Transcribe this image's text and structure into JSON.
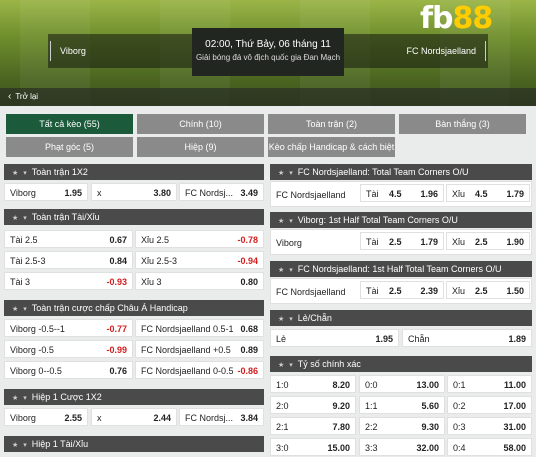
{
  "header": {
    "brand": "fb88",
    "home_team": "Viborg",
    "away_team": "FC Nordsjaelland",
    "datetime": "02:00, Thứ Bảy, 06 tháng 11",
    "league": "Giải bóng đá vô địch quốc gia Đan Mạch",
    "back_label": "Trở lại"
  },
  "filters": [
    {
      "label": "Tất cả kèo (55)",
      "active": true
    },
    {
      "label": "Chính (10)"
    },
    {
      "label": "Toàn trận (2)"
    },
    {
      "label": "Bàn thắng (3)"
    },
    {
      "label": "Phạt góc (5)"
    },
    {
      "label": "Hiệp (9)"
    },
    {
      "label": "Kèo chấp Handicap & cách biệt (1)"
    }
  ],
  "left": {
    "s1": {
      "title": "Toàn trận 1X2",
      "rows": [
        [
          {
            "lbl": "Viborg",
            "odd": "1.95"
          },
          {
            "lbl": "x",
            "odd": "3.80"
          },
          {
            "lbl": "FC Nordsj...",
            "odd": "3.49"
          }
        ]
      ]
    },
    "s2": {
      "title": "Toàn trận Tài/Xỉu",
      "rows": [
        [
          {
            "lbl": "Tài 2.5",
            "odd": "0.67"
          },
          {
            "lbl": "Xỉu 2.5",
            "odd": "-0.78"
          }
        ],
        [
          {
            "lbl": "Tài 2.5-3",
            "odd": "0.84"
          },
          {
            "lbl": "Xỉu 2.5-3",
            "odd": "-0.94"
          }
        ],
        [
          {
            "lbl": "Tài 3",
            "odd": "-0.93"
          },
          {
            "lbl": "Xỉu 3",
            "odd": "0.80"
          }
        ]
      ]
    },
    "s3": {
      "title": "Toàn trận cược chấp Châu Á Handicap",
      "rows": [
        [
          {
            "lbl": "Viborg -0.5--1",
            "odd": "-0.77"
          },
          {
            "lbl": "FC Nordsjaelland 0.5-1",
            "odd": "0.68"
          }
        ],
        [
          {
            "lbl": "Viborg -0.5",
            "odd": "-0.99"
          },
          {
            "lbl": "FC Nordsjaelland +0.5",
            "odd": "0.89"
          }
        ],
        [
          {
            "lbl": "Viborg 0--0.5",
            "odd": "0.76"
          },
          {
            "lbl": "FC Nordsjaelland 0-0.5",
            "odd": "-0.86"
          }
        ]
      ]
    },
    "s4": {
      "title": "Hiệp 1 Cược 1X2",
      "rows": [
        [
          {
            "lbl": "Viborg",
            "odd": "2.55"
          },
          {
            "lbl": "x",
            "odd": "2.44"
          },
          {
            "lbl": "FC Nordsj...",
            "odd": "3.84"
          }
        ]
      ]
    },
    "s5": {
      "title": "Hiệp 1 Tài/Xỉu"
    }
  },
  "right": {
    "r1": {
      "title": "FC Nordsjaelland: Total Team Corners O/U",
      "team": "FC Nordsjaelland",
      "cells": [
        {
          "lbl": "Tài",
          "mid": "4.5",
          "odd": "1.96"
        },
        {
          "lbl": "Xỉu",
          "mid": "4.5",
          "odd": "1.79"
        }
      ]
    },
    "r2": {
      "title": "Viborg: 1st Half Total Team Corners O/U",
      "team": "Viborg",
      "cells": [
        {
          "lbl": "Tài",
          "mid": "2.5",
          "odd": "1.79"
        },
        {
          "lbl": "Xỉu",
          "mid": "2.5",
          "odd": "1.90"
        }
      ]
    },
    "r3": {
      "title": "FC Nordsjaelland: 1st Half Total Team Corners O/U",
      "team": "FC Nordsjaelland",
      "cells": [
        {
          "lbl": "Tài",
          "mid": "2.5",
          "odd": "2.39"
        },
        {
          "lbl": "Xỉu",
          "mid": "2.5",
          "odd": "1.50"
        }
      ]
    },
    "r4": {
      "title": "Lẻ/Chẵn",
      "cells": [
        {
          "lbl": "Lẻ",
          "odd": "1.95"
        },
        {
          "lbl": "Chẵn",
          "odd": "1.89"
        }
      ]
    },
    "r5": {
      "title": "Tỷ số chính xác",
      "rows": [
        [
          {
            "lbl": "1:0",
            "odd": "8.20"
          },
          {
            "lbl": "0:0",
            "odd": "13.00"
          },
          {
            "lbl": "0:1",
            "odd": "11.00"
          }
        ],
        [
          {
            "lbl": "2:0",
            "odd": "9.20"
          },
          {
            "lbl": "1:1",
            "odd": "5.60"
          },
          {
            "lbl": "0:2",
            "odd": "17.00"
          }
        ],
        [
          {
            "lbl": "2:1",
            "odd": "7.80"
          },
          {
            "lbl": "2:2",
            "odd": "9.30"
          },
          {
            "lbl": "0:3",
            "odd": "31.00"
          }
        ],
        [
          {
            "lbl": "3:0",
            "odd": "15.00"
          },
          {
            "lbl": "3:3",
            "odd": "32.00"
          },
          {
            "lbl": "0:4",
            "odd": "58.00"
          }
        ]
      ]
    }
  }
}
